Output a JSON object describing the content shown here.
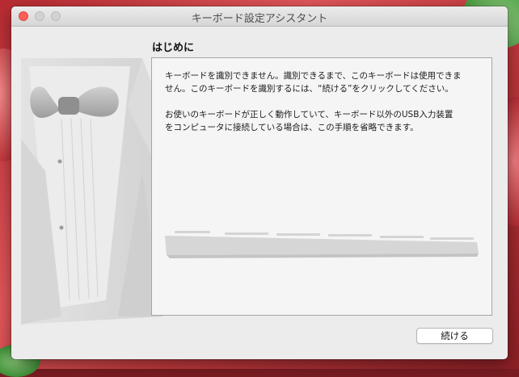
{
  "window": {
    "title": "キーボード設定アシスタント"
  },
  "content": {
    "heading": "はじめに",
    "paragraph1_line1": "キーボードを識別できません。識別できるまで、このキーボードは使用できま",
    "paragraph1_line2": "せん。このキーボードを識別するには、“続ける”をクリックしてください。",
    "paragraph2_line1": "お使いのキーボードが正しく動作していて、キーボード以外のUSB入力装置",
    "paragraph2_line2": "をコンピュータに接続している場合は、この手順を省略できます。"
  },
  "buttons": {
    "continue_label": "続ける"
  },
  "icons": {
    "artwork": "tuxedo-bowtie-illustration",
    "keyboard": "keyboard-illustration"
  },
  "colors": {
    "close": "#fc5f57",
    "window_bg": "#ececec",
    "panel_bg": "#f5f5f5"
  }
}
